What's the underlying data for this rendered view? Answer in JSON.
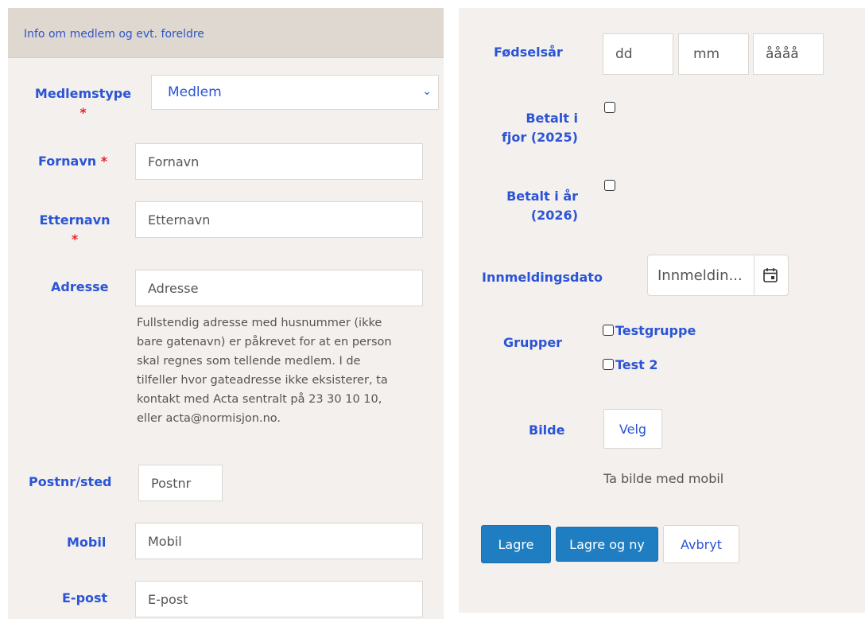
{
  "left": {
    "header": "Info om medlem og evt. foreldre",
    "required_mark": "*",
    "medlemstype": {
      "label": "Medlemstype",
      "value": "Medlem"
    },
    "fornavn": {
      "label": "Fornavn",
      "placeholder": "Fornavn"
    },
    "etternavn": {
      "label": "Etternavn",
      "placeholder": "Etternavn"
    },
    "adresse": {
      "label": "Adresse",
      "placeholder": "Adresse",
      "help": [
        "Fullstendig adresse med husnummer (ikke",
        "bare gatenavn) er påkrevet for at en person",
        "skal regnes som tellende medlem. I de",
        "tilfeller hvor gateadresse ikke eksisterer, ta",
        "kontakt med Acta sentralt på 23 30 10 10,",
        "eller acta@normisjon.no."
      ]
    },
    "postnr": {
      "label": "Postnr/sted",
      "placeholder": "Postnr"
    },
    "mobil": {
      "label": "Mobil",
      "placeholder": "Mobil"
    },
    "epost": {
      "label": "E-post",
      "placeholder": "E-post"
    }
  },
  "right": {
    "fodselsar": {
      "label": "Fødselsår",
      "dd": "dd",
      "mm": "mm",
      "yyyy": "åååå"
    },
    "betalt_ifjor": {
      "label_line1": "Betalt i",
      "label_line2": "fjor (2025)",
      "checked": false
    },
    "betalt_iar": {
      "label_line1": "Betalt i år",
      "label_line2": "(2026)",
      "checked": false
    },
    "innmeldingsdato": {
      "label": "Innmeldingsdato",
      "placeholder": "Innmeldin..."
    },
    "grupper": {
      "label": "Grupper",
      "items": [
        "Testgruppe",
        "Test 2"
      ]
    },
    "bilde": {
      "label": "Bilde",
      "button": "Velg",
      "hint": "Ta bilde med mobil"
    },
    "buttons": {
      "save": "Lagre",
      "save_new": "Lagre og ny",
      "cancel": "Avbryt"
    }
  }
}
